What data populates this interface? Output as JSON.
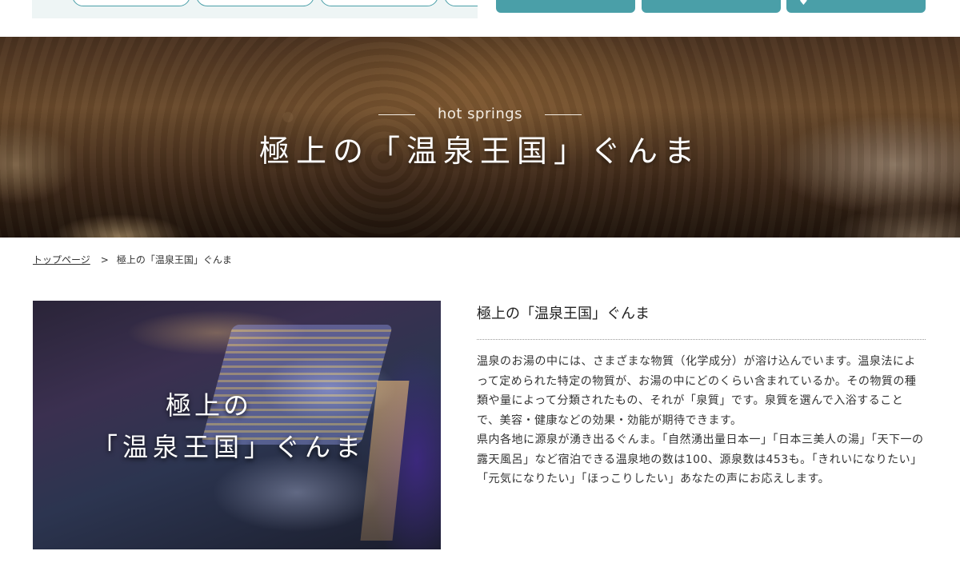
{
  "hero": {
    "subtitle": "hot springs",
    "title": "極上の「温泉王国」ぐんま"
  },
  "breadcrumb": {
    "home": "トップページ",
    "separator": ">",
    "current": "極上の「温泉王国」ぐんま"
  },
  "feature": {
    "caption_line1": "極上の",
    "caption_line2": "「温泉王国」ぐんま"
  },
  "article": {
    "title": "極上の「温泉王国」ぐんま",
    "paragraph1": "温泉のお湯の中には、さまざまな物質（化学成分）が溶け込んでいます。温泉法によって定められた特定の物質が、お湯の中にどのくらい含まれているか。その物質の種類や量によって分類されたもの、それが「泉質」です。泉質を選んで入浴することで、美容・健康などの効果・効能が期待できます。",
    "paragraph2": "県内各地に源泉が湧き出るぐんま。「自然湧出量日本一」「日本三美人の湯」「天下一の露天風呂」など宿泊できる温泉地の数は100、源泉数は453も。「きれいになりたい」「元気になりたい」「ほっこりしたい」あなたの声にお応えします。"
  },
  "colors": {
    "accent": "#4a9fa8",
    "strip_bg": "#eef5f5"
  }
}
